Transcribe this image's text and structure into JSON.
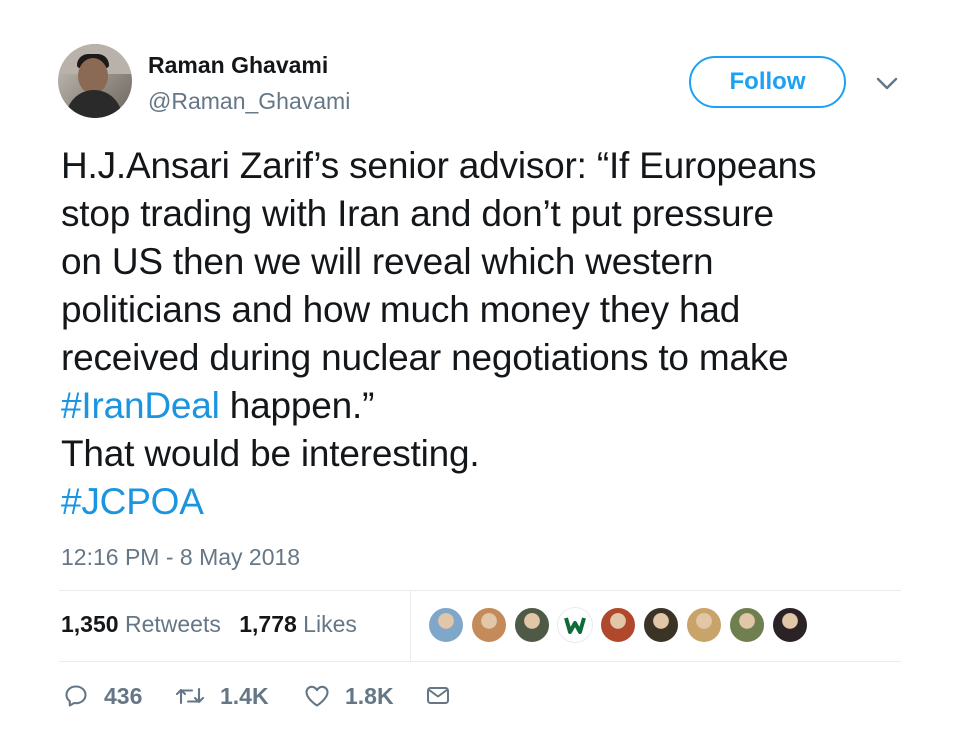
{
  "author": {
    "name": "Raman Ghavami",
    "handle": "@Raman_Ghavami"
  },
  "follow_label": "Follow",
  "tweet": {
    "lines": [
      [
        "H.J.Ansari Zarif’s senior advisor: “If Europeans",
        ""
      ],
      [
        "stop trading with Iran and don’t put pressure",
        ""
      ],
      [
        "on US then we will reveal which western",
        ""
      ],
      [
        "politicians and how much money they had",
        ""
      ],
      [
        "received during nuclear negotiations to make",
        ""
      ]
    ],
    "hashtag_irandeal": "#IranDeal",
    "after_irandeal": " happen.”",
    "line_interesting": "That would be interesting.",
    "hashtag_jcpoa": "#JCPOA"
  },
  "timestamp": "12:16 PM - 8 May 2018",
  "stats": {
    "retweets_count": "1,350",
    "retweets_label": "Retweets",
    "likes_count": "1,778",
    "likes_label": "Likes"
  },
  "likers": [
    {
      "icon": "liker-avatar",
      "color": "#7fa7c9"
    },
    {
      "icon": "liker-avatar",
      "color": "#c48a5a"
    },
    {
      "icon": "liker-avatar",
      "color": "#4e5a46"
    },
    {
      "icon": "liker-avatar-logo",
      "color": "#0f6b3a"
    },
    {
      "icon": "liker-avatar",
      "color": "#b0482c"
    },
    {
      "icon": "liker-avatar",
      "color": "#3b3325"
    },
    {
      "icon": "liker-avatar",
      "color": "#c9a46a"
    },
    {
      "icon": "liker-avatar",
      "color": "#6f7f4f"
    },
    {
      "icon": "liker-avatar",
      "color": "#2a2226"
    }
  ],
  "actions": {
    "replies": "436",
    "retweets": "1.4K",
    "likes": "1.8K"
  },
  "colors": {
    "accent": "#1da1f2",
    "hashtag": "#1b95e0",
    "secondary_text": "#657786"
  }
}
